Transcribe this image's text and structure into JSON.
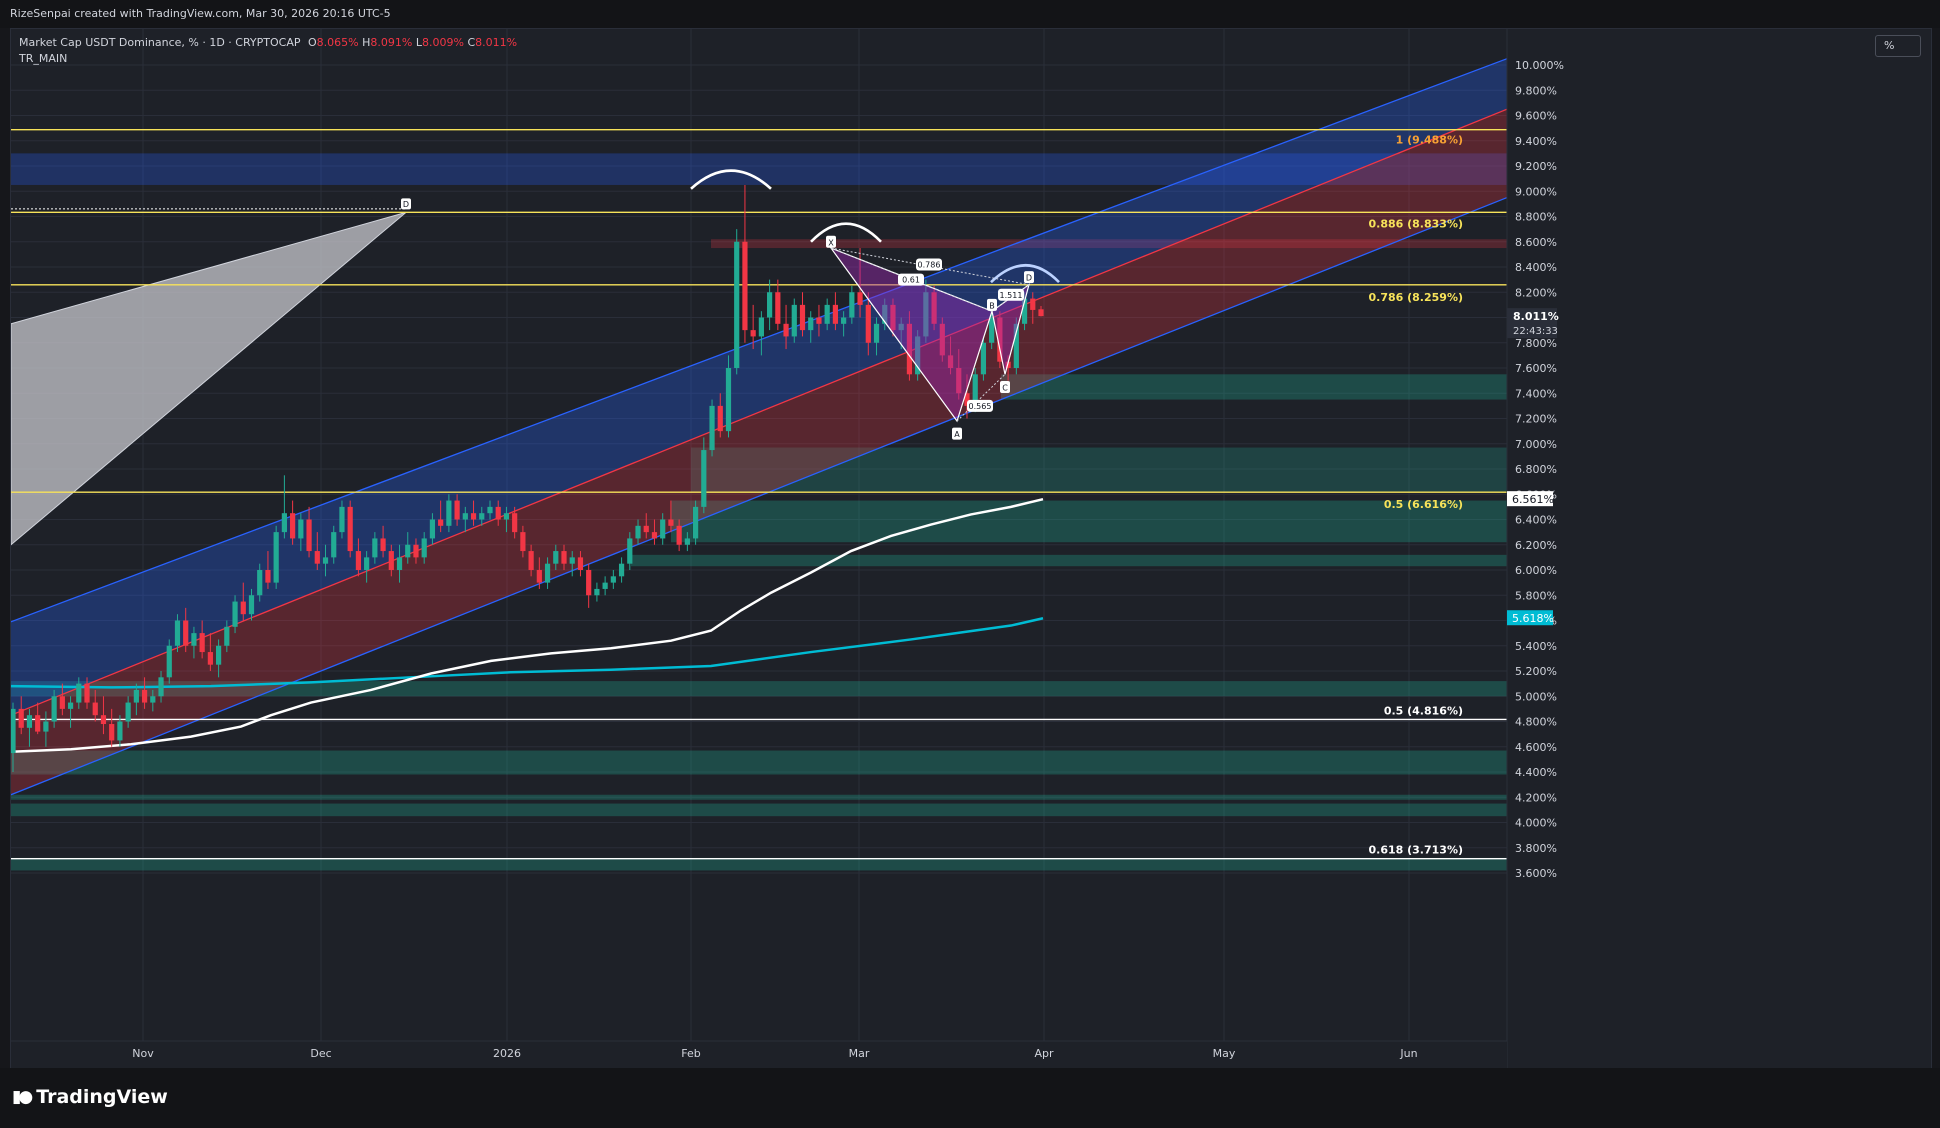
{
  "header": {
    "credit": "RizeSenpai created with TradingView.com, Mar 30, 2026 20:16 UTC-5"
  },
  "legend": {
    "symbol": "Market Cap USDT Dominance, % · 1D · CRYPTOCAP",
    "open_label": "O",
    "open": "8.065%",
    "high_label": "H",
    "high": "8.091%",
    "low_label": "L",
    "low": "8.009%",
    "close_label": "C",
    "close": "8.011%",
    "indicator": "TR_MAIN"
  },
  "scale_button": "%",
  "footer": {
    "logo_text": "TradingView"
  },
  "colors": {
    "up": "#22ab94",
    "down": "#f23645",
    "accent_yellow": "#f7e35a",
    "ma_white": "#ffffff",
    "ma_cyan": "#00bcd4"
  },
  "chart_data": {
    "type": "candlestick",
    "x_axis": [
      "Nov",
      "Dec",
      "2026",
      "Feb",
      "Mar",
      "Apr",
      "May",
      "Jun"
    ],
    "y_axis": [
      "10.000%",
      "9.800%",
      "9.600%",
      "9.400%",
      "9.200%",
      "9.000%",
      "8.800%",
      "8.600%",
      "8.400%",
      "8.200%",
      "8.000%",
      "7.800%",
      "7.600%",
      "7.400%",
      "7.200%",
      "7.000%",
      "6.800%",
      "6.600%",
      "6.400%",
      "6.200%",
      "6.000%",
      "5.800%",
      "5.600%",
      "5.400%",
      "5.200%",
      "5.000%",
      "4.800%",
      "4.600%",
      "4.400%",
      "4.200%",
      "4.000%",
      "3.800%",
      "3.600%"
    ],
    "ylim": [
      3.55,
      10.1
    ],
    "current_price": {
      "value": "8.011%",
      "countdown": "22:43:33"
    },
    "ma_labels": [
      {
        "value": "6.561%",
        "color": "#ffffff"
      },
      {
        "value": "5.618%",
        "color": "#00bcd4"
      }
    ],
    "fib_levels": [
      {
        "label": "1 (9.488%)",
        "value": 9.488,
        "color": "#f7a133"
      },
      {
        "label": "0.886 (8.833%)",
        "value": 8.833,
        "color": "#f7e35a"
      },
      {
        "label": "0.786 (8.259%)",
        "value": 8.259,
        "color": "#f7e35a"
      },
      {
        "label": "0.5 (6.616%)",
        "value": 6.616,
        "color": "#f7e35a"
      },
      {
        "label": "0.5 (4.816%)",
        "value": 4.816,
        "color": "#ffffff"
      },
      {
        "label": "0.618 (3.713%)",
        "value": 3.713,
        "color": "#ffffff"
      }
    ],
    "harmonic_points": [
      "X",
      "A",
      "B",
      "C",
      "D"
    ],
    "harmonic_ratios": [
      "0.786",
      "0.61",
      "1.511",
      "0.565"
    ],
    "triangle_label": "D",
    "candles": [
      [
        4.55,
        4.95,
        4.4,
        4.9
      ],
      [
        4.9,
        5.0,
        4.7,
        4.75
      ],
      [
        4.75,
        4.9,
        4.6,
        4.85
      ],
      [
        4.85,
        4.95,
        4.7,
        4.72
      ],
      [
        4.72,
        4.88,
        4.6,
        4.8
      ],
      [
        4.8,
        5.05,
        4.75,
        5.0
      ],
      [
        5.0,
        5.1,
        4.85,
        4.9
      ],
      [
        4.9,
        5.0,
        4.75,
        4.95
      ],
      [
        4.95,
        5.15,
        4.9,
        5.1
      ],
      [
        5.1,
        5.15,
        4.9,
        4.95
      ],
      [
        4.95,
        5.05,
        4.8,
        4.85
      ],
      [
        4.85,
        5.0,
        4.7,
        4.78
      ],
      [
        4.78,
        4.9,
        4.6,
        4.65
      ],
      [
        4.65,
        4.85,
        4.6,
        4.8
      ],
      [
        4.8,
        5.0,
        4.75,
        4.95
      ],
      [
        4.95,
        5.1,
        4.85,
        5.05
      ],
      [
        5.05,
        5.15,
        4.9,
        4.95
      ],
      [
        4.95,
        5.05,
        4.88,
        5.0
      ],
      [
        5.0,
        5.2,
        4.95,
        5.15
      ],
      [
        5.15,
        5.45,
        5.1,
        5.4
      ],
      [
        5.4,
        5.65,
        5.35,
        5.6
      ],
      [
        5.6,
        5.7,
        5.35,
        5.4
      ],
      [
        5.4,
        5.55,
        5.3,
        5.5
      ],
      [
        5.5,
        5.6,
        5.3,
        5.35
      ],
      [
        5.35,
        5.5,
        5.2,
        5.25
      ],
      [
        5.25,
        5.45,
        5.15,
        5.4
      ],
      [
        5.4,
        5.6,
        5.35,
        5.55
      ],
      [
        5.55,
        5.8,
        5.5,
        5.75
      ],
      [
        5.75,
        5.9,
        5.6,
        5.65
      ],
      [
        5.65,
        5.85,
        5.6,
        5.8
      ],
      [
        5.8,
        6.05,
        5.75,
        6.0
      ],
      [
        6.0,
        6.15,
        5.85,
        5.9
      ],
      [
        5.9,
        6.35,
        5.85,
        6.3
      ],
      [
        6.3,
        6.75,
        6.25,
        6.45
      ],
      [
        6.45,
        6.55,
        6.2,
        6.25
      ],
      [
        6.25,
        6.45,
        6.15,
        6.4
      ],
      [
        6.4,
        6.5,
        6.1,
        6.15
      ],
      [
        6.15,
        6.3,
        6.0,
        6.05
      ],
      [
        6.05,
        6.2,
        5.95,
        6.1
      ],
      [
        6.1,
        6.35,
        6.05,
        6.3
      ],
      [
        6.3,
        6.55,
        6.25,
        6.5
      ],
      [
        6.5,
        6.55,
        6.1,
        6.15
      ],
      [
        6.15,
        6.25,
        5.95,
        6.0
      ],
      [
        6.0,
        6.15,
        5.9,
        6.1
      ],
      [
        6.1,
        6.3,
        6.05,
        6.25
      ],
      [
        6.25,
        6.35,
        6.1,
        6.15
      ],
      [
        6.15,
        6.2,
        5.95,
        6.0
      ],
      [
        6.0,
        6.2,
        5.9,
        6.1
      ],
      [
        6.1,
        6.3,
        6.05,
        6.2
      ],
      [
        6.2,
        6.25,
        6.05,
        6.1
      ],
      [
        6.1,
        6.3,
        6.05,
        6.25
      ],
      [
        6.25,
        6.45,
        6.2,
        6.4
      ],
      [
        6.4,
        6.55,
        6.3,
        6.35
      ],
      [
        6.35,
        6.6,
        6.3,
        6.55
      ],
      [
        6.55,
        6.6,
        6.35,
        6.4
      ],
      [
        6.4,
        6.5,
        6.3,
        6.45
      ],
      [
        6.45,
        6.55,
        6.35,
        6.4
      ],
      [
        6.4,
        6.5,
        6.35,
        6.45
      ],
      [
        6.45,
        6.55,
        6.4,
        6.5
      ],
      [
        6.5,
        6.55,
        6.35,
        6.4
      ],
      [
        6.4,
        6.5,
        6.3,
        6.45
      ],
      [
        6.45,
        6.5,
        6.25,
        6.3
      ],
      [
        6.3,
        6.35,
        6.1,
        6.15
      ],
      [
        6.15,
        6.2,
        5.95,
        6.0
      ],
      [
        6.0,
        6.1,
        5.85,
        5.9
      ],
      [
        5.9,
        6.1,
        5.85,
        6.05
      ],
      [
        6.05,
        6.2,
        6.0,
        6.15
      ],
      [
        6.15,
        6.2,
        6.0,
        6.05
      ],
      [
        6.05,
        6.15,
        5.95,
        6.1
      ],
      [
        6.1,
        6.15,
        5.95,
        6.0
      ],
      [
        6.0,
        6.05,
        5.7,
        5.8
      ],
      [
        5.8,
        5.9,
        5.75,
        5.85
      ],
      [
        5.85,
        5.95,
        5.8,
        5.9
      ],
      [
        5.9,
        6.0,
        5.85,
        5.95
      ],
      [
        5.95,
        6.1,
        5.9,
        6.05
      ],
      [
        6.05,
        6.3,
        6.0,
        6.25
      ],
      [
        6.25,
        6.4,
        6.2,
        6.35
      ],
      [
        6.35,
        6.45,
        6.25,
        6.3
      ],
      [
        6.3,
        6.4,
        6.2,
        6.25
      ],
      [
        6.25,
        6.45,
        6.2,
        6.4
      ],
      [
        6.4,
        6.55,
        6.3,
        6.35
      ],
      [
        6.35,
        6.4,
        6.15,
        6.2
      ],
      [
        6.2,
        6.3,
        6.15,
        6.25
      ],
      [
        6.25,
        6.55,
        6.2,
        6.5
      ],
      [
        6.5,
        7.05,
        6.45,
        6.95
      ],
      [
        6.95,
        7.35,
        6.9,
        7.3
      ],
      [
        7.3,
        7.4,
        7.05,
        7.1
      ],
      [
        7.1,
        7.7,
        7.05,
        7.6
      ],
      [
        7.6,
        8.7,
        7.55,
        8.6
      ],
      [
        8.6,
        9.05,
        7.8,
        7.9
      ],
      [
        7.9,
        8.1,
        7.75,
        7.85
      ],
      [
        7.85,
        8.05,
        7.7,
        8.0
      ],
      [
        8.0,
        8.3,
        7.9,
        8.2
      ],
      [
        8.2,
        8.3,
        7.9,
        7.95
      ],
      [
        7.95,
        8.1,
        7.75,
        7.85
      ],
      [
        7.85,
        8.15,
        7.8,
        8.1
      ],
      [
        8.1,
        8.2,
        7.85,
        7.9
      ],
      [
        7.9,
        8.05,
        7.8,
        8.0
      ],
      [
        8.0,
        8.1,
        7.85,
        7.95
      ],
      [
        7.95,
        8.15,
        7.9,
        8.1
      ],
      [
        8.1,
        8.2,
        7.9,
        7.95
      ],
      [
        7.95,
        8.05,
        7.85,
        8.0
      ],
      [
        8.0,
        8.25,
        7.95,
        8.2
      ],
      [
        8.2,
        8.55,
        8.0,
        8.1
      ],
      [
        8.1,
        8.2,
        7.7,
        7.8
      ],
      [
        7.8,
        8.0,
        7.7,
        7.95
      ],
      [
        7.95,
        8.15,
        7.9,
        8.1
      ],
      [
        8.1,
        8.15,
        7.85,
        7.9
      ],
      [
        7.9,
        8.0,
        7.75,
        7.95
      ],
      [
        7.95,
        8.05,
        7.5,
        7.55
      ],
      [
        7.55,
        7.9,
        7.5,
        7.85
      ],
      [
        7.85,
        8.3,
        7.8,
        8.2
      ],
      [
        8.2,
        8.25,
        7.9,
        7.95
      ],
      [
        7.95,
        8.0,
        7.65,
        7.7
      ],
      [
        7.7,
        7.85,
        7.55,
        7.6
      ],
      [
        7.6,
        7.75,
        7.35,
        7.4
      ],
      [
        7.4,
        7.55,
        7.2,
        7.3
      ],
      [
        7.3,
        7.6,
        7.25,
        7.55
      ],
      [
        7.55,
        7.85,
        7.5,
        7.8
      ],
      [
        7.8,
        8.05,
        7.75,
        8.0
      ],
      [
        8.0,
        8.05,
        7.6,
        7.65
      ],
      [
        7.65,
        7.7,
        7.5,
        7.6
      ],
      [
        7.6,
        8.0,
        7.55,
        7.95
      ],
      [
        7.95,
        8.2,
        7.9,
        8.15
      ],
      [
        8.15,
        8.2,
        7.95,
        8.06
      ],
      [
        8.065,
        8.091,
        8.009,
        8.011
      ]
    ]
  }
}
